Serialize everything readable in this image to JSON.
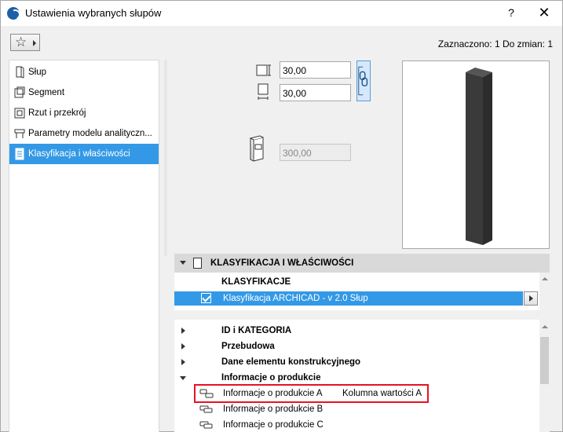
{
  "window": {
    "title": "Ustawienia wybranych słupów",
    "help_label": "?",
    "close_label": "✕"
  },
  "toolbar": {
    "favorites_icon": "star-icon",
    "status_text": "Zaznaczono: 1 Do zmian: 1"
  },
  "sidebar": {
    "items": [
      {
        "label": "Słup",
        "icon": "column-icon",
        "selected": false
      },
      {
        "label": "Segment",
        "icon": "segment-icon",
        "selected": false
      },
      {
        "label": "Rzut i przekrój",
        "icon": "floorplan-section-icon",
        "selected": false
      },
      {
        "label": "Parametry modelu analityczn...",
        "icon": "analytical-model-icon",
        "selected": false
      },
      {
        "label": "Klasyfikacja i właściwości",
        "icon": "classification-icon",
        "selected": true
      }
    ]
  },
  "geometry_fields": {
    "width_value": "30,00",
    "depth_value": "30,00",
    "height_value": "300,00"
  },
  "classification_panel": {
    "header_label": "KLASYFIKACJA I WŁAŚCIWOŚCI",
    "section_heading": "KLASYFIKACJE",
    "selected_row": {
      "label": "Klasyfikacja ARCHICAD - v 2.0 Słup",
      "checked": true
    }
  },
  "properties": {
    "groups": [
      {
        "label": "ID i KATEGORIA",
        "expanded": false
      },
      {
        "label": "Przebudowa",
        "expanded": false
      },
      {
        "label": "Dane elementu konstrukcyjnego",
        "expanded": false
      },
      {
        "label": "Informacje o produkcie",
        "expanded": true
      }
    ],
    "items": [
      {
        "label": "Informacje o produkcie A",
        "value": "Kolumna wartości A"
      },
      {
        "label": "Informacje o produkcie B",
        "value": ""
      },
      {
        "label": "Informacje o produkcie C",
        "value": ""
      }
    ]
  },
  "colors": {
    "selection": "#3399e6",
    "highlight_border": "#e81123",
    "column_fill": "#3a3a3a"
  }
}
